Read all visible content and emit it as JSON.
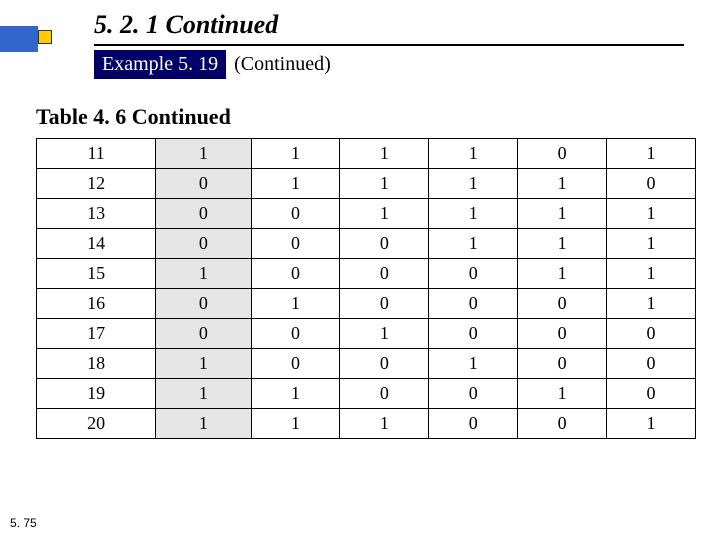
{
  "heading": "5. 2. 1 Continued",
  "example_label": "Example 5. 19",
  "example_suffix": "(Continued)",
  "table_caption": "Table 4. 6   Continued",
  "page_number": "5. 75",
  "chart_data": {
    "type": "table",
    "rows": [
      {
        "index": "11",
        "hl": "1",
        "c": [
          "1",
          "1",
          "1",
          "0",
          "1"
        ]
      },
      {
        "index": "12",
        "hl": "0",
        "c": [
          "1",
          "1",
          "1",
          "1",
          "0"
        ]
      },
      {
        "index": "13",
        "hl": "0",
        "c": [
          "0",
          "1",
          "1",
          "1",
          "1"
        ]
      },
      {
        "index": "14",
        "hl": "0",
        "c": [
          "0",
          "0",
          "1",
          "1",
          "1"
        ]
      },
      {
        "index": "15",
        "hl": "1",
        "c": [
          "0",
          "0",
          "0",
          "1",
          "1"
        ]
      },
      {
        "index": "16",
        "hl": "0",
        "c": [
          "1",
          "0",
          "0",
          "0",
          "1"
        ]
      },
      {
        "index": "17",
        "hl": "0",
        "c": [
          "0",
          "1",
          "0",
          "0",
          "0"
        ]
      },
      {
        "index": "18",
        "hl": "1",
        "c": [
          "0",
          "0",
          "1",
          "0",
          "0"
        ]
      },
      {
        "index": "19",
        "hl": "1",
        "c": [
          "1",
          "0",
          "0",
          "1",
          "0"
        ]
      },
      {
        "index": "20",
        "hl": "1",
        "c": [
          "1",
          "1",
          "0",
          "0",
          "1"
        ]
      }
    ]
  }
}
